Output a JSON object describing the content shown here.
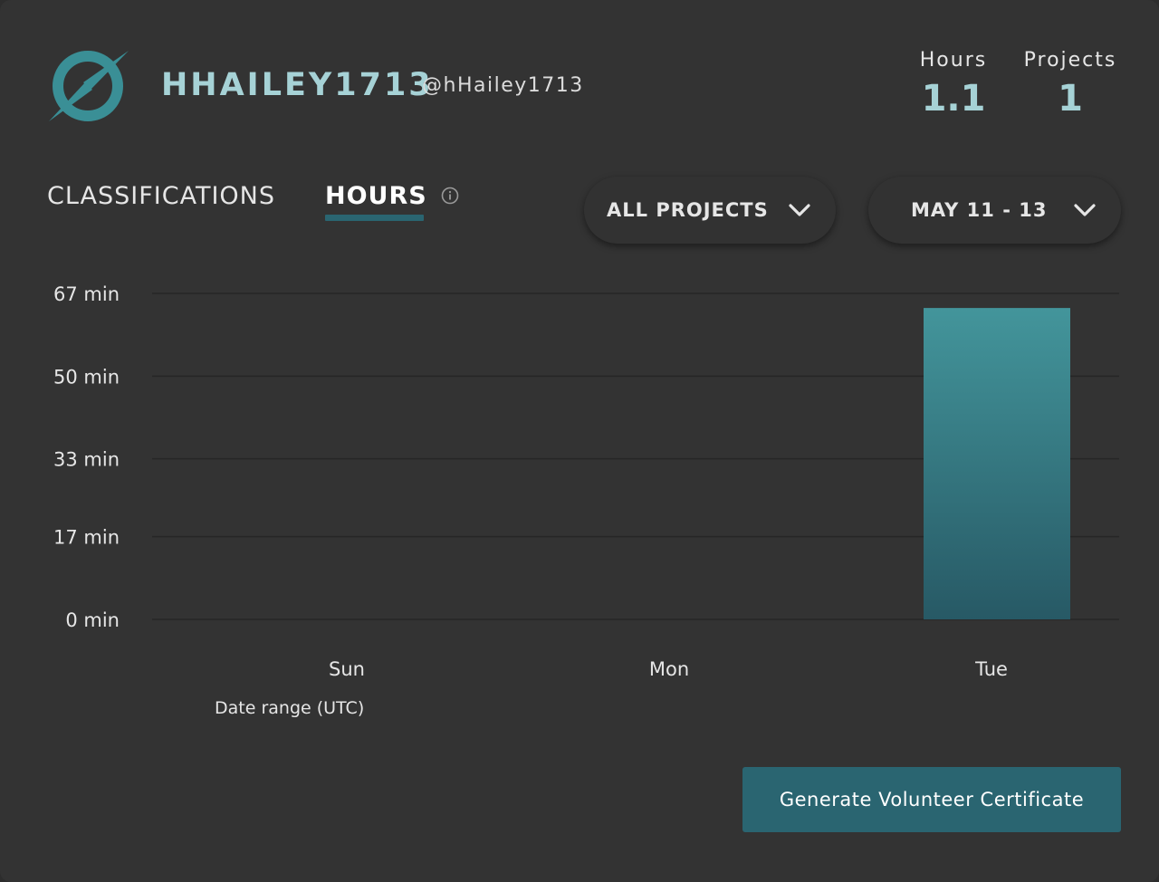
{
  "profile": {
    "display_name": "HHAILEY1713",
    "handle": "@hHailey1713",
    "logo_icon": "zooniverse-logo-icon"
  },
  "stats": {
    "hours_label": "Hours",
    "hours_value": "1.1",
    "projects_label": "Projects",
    "projects_value": "1"
  },
  "tabs": {
    "classifications_label": "CLASSIFICATIONS",
    "hours_label": "HOURS",
    "active": "HOURS",
    "info_icon": "info-icon"
  },
  "filters": {
    "project_select": "ALL PROJECTS",
    "date_select": "MAY 11 - 13",
    "chevron_icon": "chevron-down-icon"
  },
  "colors": {
    "accent": "#a6d2d6",
    "brand_teal": "#2a6571",
    "bar_top": "#43959b",
    "bar_bottom": "#275965",
    "background": "#333333"
  },
  "chart_data": {
    "type": "bar",
    "categories": [
      "Sun",
      "Mon",
      "Tue"
    ],
    "values": [
      0,
      0,
      64
    ],
    "y_ticks": [
      0,
      17,
      33,
      50,
      67
    ],
    "y_tick_labels": [
      "0 min",
      "17 min",
      "33 min",
      "50 min",
      "67 min"
    ],
    "ylim": [
      0,
      67
    ],
    "xlabel": "Date range (UTC)",
    "ylabel": "",
    "grid": true
  },
  "actions": {
    "certificate_label": "Generate Volunteer Certificate"
  }
}
